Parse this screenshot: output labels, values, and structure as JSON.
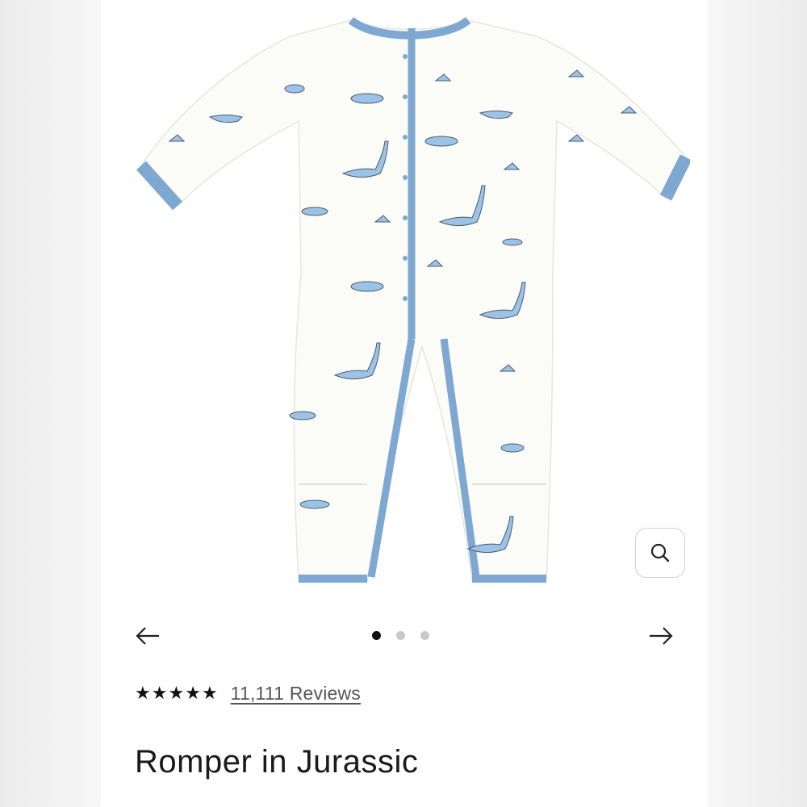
{
  "product": {
    "title": "Romper in Jurassic",
    "rating_stars": 5,
    "reviews_label": "11,111 Reviews",
    "image_alt": "Romper with dinosaur print and blue trim"
  },
  "gallery": {
    "total_images": 3,
    "active_index": 0
  },
  "icons": {
    "zoom": "search-icon",
    "prev": "arrow-left-icon",
    "next": "arrow-right-icon",
    "star": "star-icon"
  },
  "colors": {
    "trim_blue": "#7ea7d2",
    "fabric": "#fbfbf7",
    "dino_blue": "#9cc3e6",
    "text_dark": "#1a1a1a"
  }
}
